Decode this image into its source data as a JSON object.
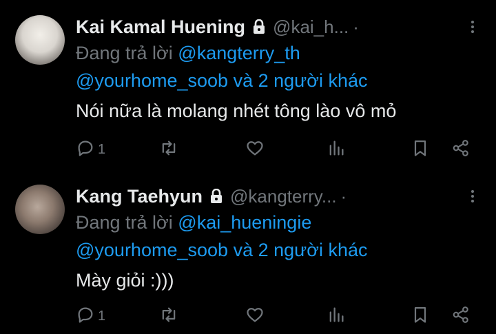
{
  "tweets": [
    {
      "name": "Kai Kamal Huening",
      "handle": "@kai_h...",
      "separator": "·",
      "replying_prefix": "Đang trả lời",
      "replying_to": "@kangterry_th",
      "mention_1": "@yourhome_soob",
      "mention_join": "và",
      "mention_others": "2 người khác",
      "text": "Nói nữa là molang nhét tông lào vô mỏ",
      "reply_count": "1"
    },
    {
      "name": "Kang Taehyun",
      "handle": "@kangterry...",
      "separator": "·",
      "replying_prefix": "Đang trả lời",
      "replying_to": "@kai_hueningie",
      "mention_1": "@yourhome_soob",
      "mention_join": "và",
      "mention_others": "2 người khác",
      "text": "Mày giỏi :)))",
      "reply_count": "1"
    }
  ],
  "colors": {
    "background": "#000000",
    "text": "#e7e9ea",
    "muted": "#71767b",
    "link": "#1d9bf0"
  },
  "icons": [
    "lock-icon",
    "more-icon",
    "reply-icon",
    "retweet-icon",
    "like-icon",
    "views-icon",
    "bookmark-icon",
    "share-icon"
  ]
}
